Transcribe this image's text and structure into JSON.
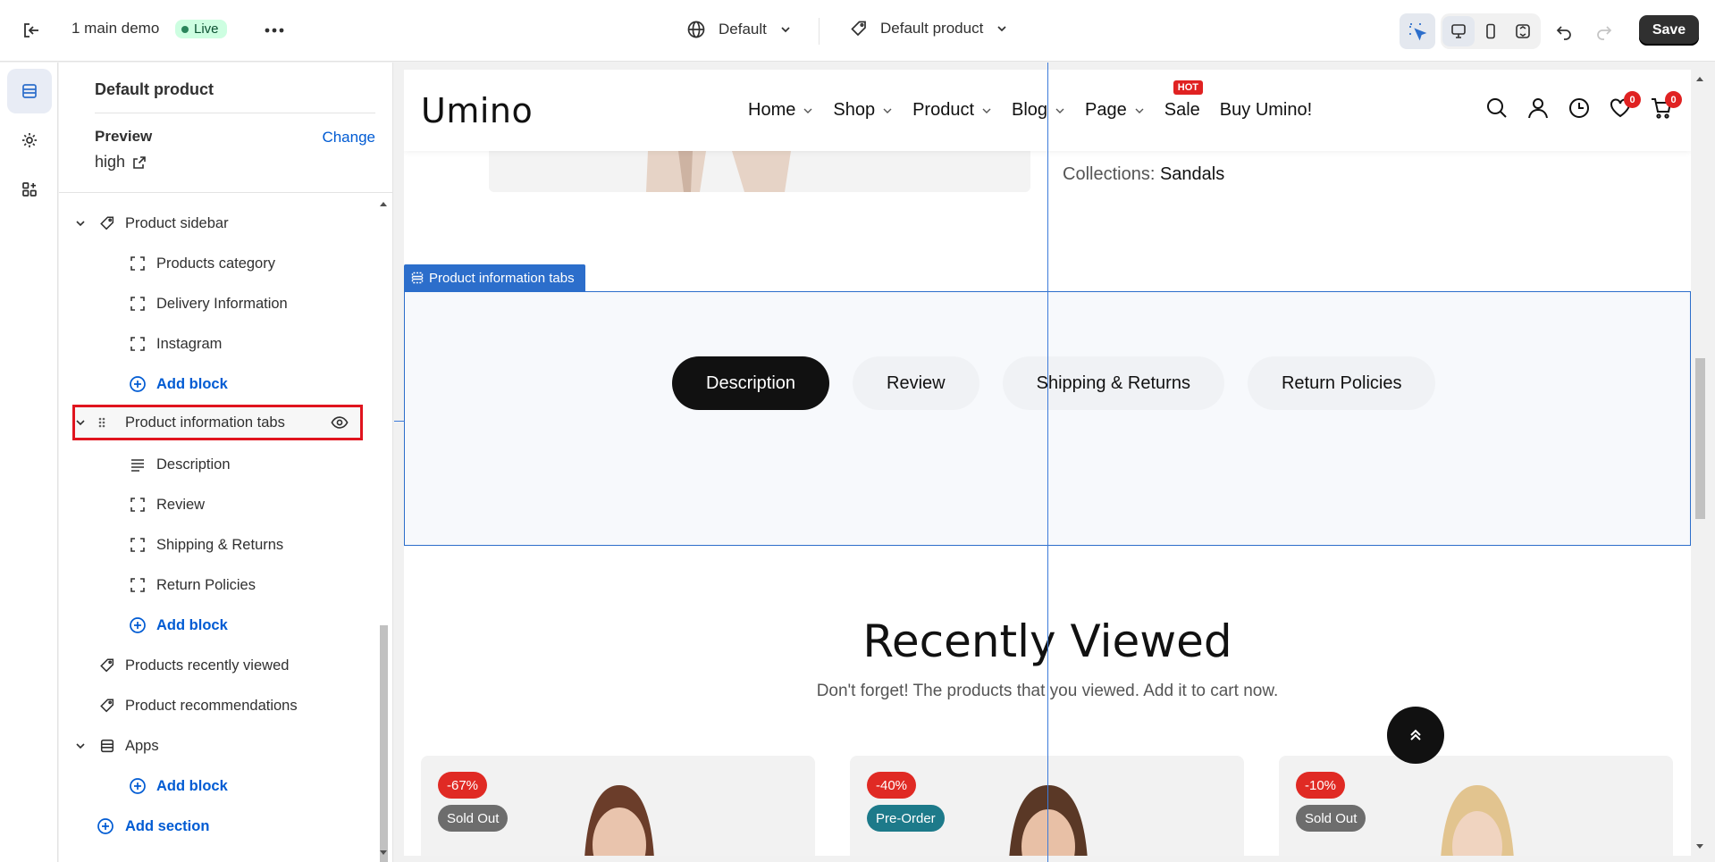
{
  "topbar": {
    "theme_name": "1 main demo",
    "status": "Live",
    "language": "Default",
    "template": "Default product",
    "save_label": "Save"
  },
  "panel": {
    "title": "Default product",
    "preview_label": "Preview",
    "change_label": "Change",
    "preview_value": "high"
  },
  "tree": {
    "product_sidebar": "Product sidebar",
    "products_category": "Products category",
    "delivery_information": "Delivery Information",
    "instagram": "Instagram",
    "add_block": "Add block",
    "product_information_tabs": "Product information tabs",
    "description": "Description",
    "review": "Review",
    "shipping_returns": "Shipping & Returns",
    "return_policies": "Return Policies",
    "products_recently_viewed": "Products recently viewed",
    "product_recommendations": "Product recommendations",
    "apps": "Apps",
    "add_section": "Add section"
  },
  "site": {
    "logo": "Umino",
    "nav": [
      "Home",
      "Shop",
      "Product",
      "Blog",
      "Page",
      "Sale",
      "Buy Umino!"
    ],
    "hot_badge": "HOT",
    "wishlist_count": "0",
    "cart_count": "0",
    "collections_label": "Collections:",
    "collections_value": "Sandals",
    "section_tag": "Product information tabs",
    "tabs": [
      "Description",
      "Review",
      "Shipping & Returns",
      "Return Policies"
    ],
    "recently_title": "Recently Viewed",
    "recently_sub": "Don't forget! The products that you viewed. Add it to cart now.",
    "cards": [
      {
        "discount": "-67%",
        "status": "Sold Out"
      },
      {
        "discount": "-40%",
        "status": "Pre-Order"
      },
      {
        "discount": "-10%",
        "status": "Sold Out"
      }
    ]
  }
}
